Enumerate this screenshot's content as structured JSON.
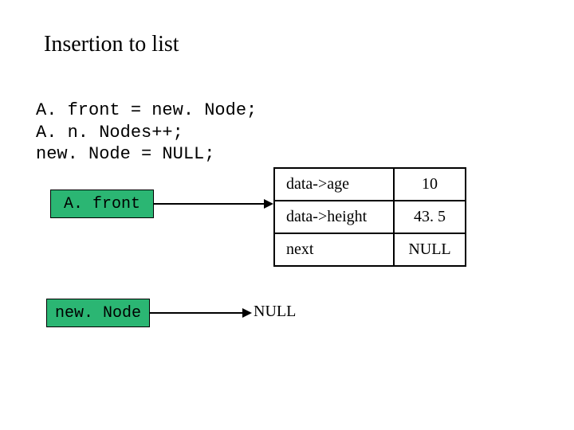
{
  "title": "Insertion to list",
  "code": {
    "line1": "A. front = new. Node;",
    "line2": "A. n. Nodes++;",
    "line3": "new. Node = NULL;"
  },
  "boxes": {
    "afront": "A. front",
    "newnode": "new. Node"
  },
  "table": {
    "r0_key": "data->age",
    "r0_val": "10",
    "r1_key": "data->height",
    "r1_val": "43. 5",
    "r2_key": "next",
    "r2_val": "NULL"
  },
  "null_label": "NULL"
}
